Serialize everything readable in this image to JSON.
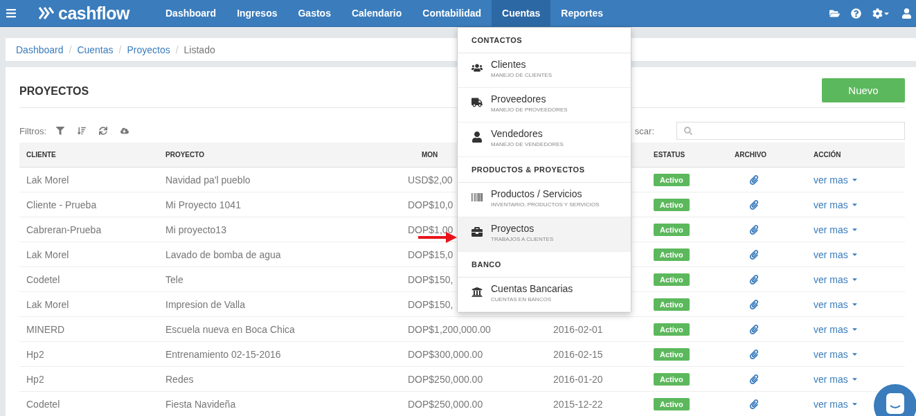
{
  "navbar": {
    "logo": "cashflow",
    "items": [
      {
        "label": "Dashboard",
        "selected": false
      },
      {
        "label": "Ingresos",
        "selected": false
      },
      {
        "label": "Gastos",
        "selected": false
      },
      {
        "label": "Calendario",
        "selected": false
      },
      {
        "label": "Contabilidad",
        "selected": false
      },
      {
        "label": "Cuentas",
        "selected": true
      },
      {
        "label": "Reportes",
        "selected": false
      }
    ]
  },
  "breadcrumb": [
    {
      "label": "Dashboard"
    },
    {
      "separator": "/",
      "label": "Cuentas"
    },
    {
      "separator": "/",
      "label": "Proyectos"
    },
    {
      "separator": "/",
      "label": "Listado"
    }
  ],
  "panel": {
    "title": "PROYECTOS",
    "new_button": "Nuevo",
    "filters_label": "Filtros:",
    "search_label": "scar:"
  },
  "table": {
    "columns": [
      "CLIENTE",
      "PROYECTO",
      "MON",
      "ESTATUS",
      "ARCHIVO",
      "ACCIÓN"
    ],
    "rows": [
      {
        "cliente": "Lak Morel",
        "proyecto": "Navidad pa'l pueblo",
        "monto": "USD$2,00",
        "estatus": "Activo",
        "accion": "ver mas"
      },
      {
        "cliente": "Cliente - Prueba",
        "proyecto": "Mi Proyecto 1041",
        "monto": "DOP$10,0",
        "estatus": "Activo",
        "accion": "ver mas"
      },
      {
        "cliente": "Cabreran-Prueba",
        "proyecto": "Mi proyecto13",
        "monto": "DOP$1,00",
        "estatus": "Activo",
        "accion": "ver mas"
      },
      {
        "cliente": "Lak Morel",
        "proyecto": "Lavado de bomba de agua",
        "monto": "DOP$15,0",
        "estatus": "Activo",
        "accion": "ver mas"
      },
      {
        "cliente": "Codetel",
        "proyecto": "Tele",
        "monto": "DOP$150,",
        "estatus": "Activo",
        "accion": "ver mas"
      },
      {
        "cliente": "Lak Morel",
        "proyecto": "Impresion de Valla",
        "monto": "DOP$150,",
        "estatus": "Activo",
        "accion": "ver mas"
      },
      {
        "cliente": "MINERD",
        "proyecto": "Escuela nueva en Boca Chica",
        "monto": "DOP$1,200,000.00",
        "fecha": "2016-02-01",
        "estatus": "Activo",
        "accion": "ver mas"
      },
      {
        "cliente": "Hp2",
        "proyecto": "Entrenamiento 02-15-2016",
        "monto": "DOP$300,000.00",
        "fecha": "2016-02-15",
        "estatus": "Activo",
        "accion": "ver mas"
      },
      {
        "cliente": "Hp2",
        "proyecto": "Redes",
        "monto": "DOP$250,000.00",
        "fecha": "2016-01-20",
        "estatus": "Activo",
        "accion": "ver mas"
      },
      {
        "cliente": "Codetel",
        "proyecto": "Fiesta Navideña",
        "monto": "DOP$250,000.00",
        "fecha": "2015-12-22",
        "estatus": "Activo",
        "accion": "ver mas"
      }
    ]
  },
  "dropdown": {
    "sections": [
      {
        "title": "CONTACTOS",
        "items": [
          {
            "label": "Clientes",
            "subtitle": "MANEJO DE CLIENTES",
            "selected": false
          },
          {
            "label": "Proveedores",
            "subtitle": "MANEJO DE PROVEEDORES",
            "selected": false
          },
          {
            "label": "Vendedores",
            "subtitle": "MANEJO DE VENDEDORES",
            "selected": false
          }
        ]
      },
      {
        "title": "PRODUCTOS & PROYECTOS",
        "items": [
          {
            "label": "Productos / Servicios",
            "subtitle": "INVENTARIO, PRODUCTOS Y SERVICIOS",
            "selected": false
          },
          {
            "label": "Proyectos",
            "subtitle": "TRABAJOS A CLIENTES",
            "selected": true
          }
        ]
      },
      {
        "title": "BANCO",
        "items": [
          {
            "label": "Cuentas Bancarias",
            "subtitle": "CUENTAS EN BANCOS",
            "selected": false
          }
        ]
      }
    ]
  }
}
